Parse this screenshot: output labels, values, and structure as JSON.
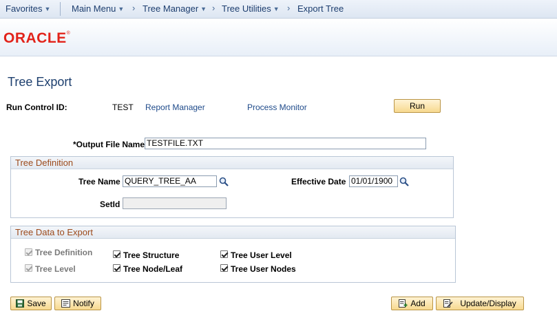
{
  "nav": {
    "favorites": "Favorites",
    "main_menu": "Main Menu",
    "tree_manager": "Tree Manager",
    "tree_utilities": "Tree Utilities",
    "export_tree": "Export Tree"
  },
  "brand": {
    "logo": "ORACLE",
    "mark": "®",
    "color": "#e2231a"
  },
  "page": {
    "title": "Tree Export",
    "run_control_label": "Run Control ID:",
    "run_control_value": "TEST",
    "report_manager": "Report Manager",
    "process_monitor": "Process Monitor",
    "run_button": "Run",
    "output_file_label": "*Output File Name",
    "output_file_value": "TESTFILE.TXT"
  },
  "tree_definition": {
    "heading": "Tree Definition",
    "tree_name_label": "Tree Name",
    "tree_name_value": "QUERY_TREE_AA",
    "effective_date_label": "Effective Date",
    "effective_date_value": "01/01/1900",
    "setid_label": "SetId",
    "setid_value": ""
  },
  "tree_data": {
    "heading": "Tree Data to Export",
    "options": [
      {
        "label": "Tree Definition",
        "checked": true,
        "disabled": true
      },
      {
        "label": "Tree Level",
        "checked": true,
        "disabled": true
      },
      {
        "label": "Tree Structure",
        "checked": true,
        "disabled": false
      },
      {
        "label": "Tree Node/Leaf",
        "checked": true,
        "disabled": false
      },
      {
        "label": "Tree User Level",
        "checked": true,
        "disabled": false
      },
      {
        "label": "Tree User Nodes",
        "checked": true,
        "disabled": false
      }
    ]
  },
  "footer": {
    "save": "Save",
    "notify": "Notify",
    "add": "Add",
    "update_display": "Update/Display"
  },
  "icons": {
    "lookup": "magnifier-icon",
    "save": "save-icon",
    "notify": "notify-icon",
    "add": "add-icon",
    "update": "update-display-icon"
  }
}
